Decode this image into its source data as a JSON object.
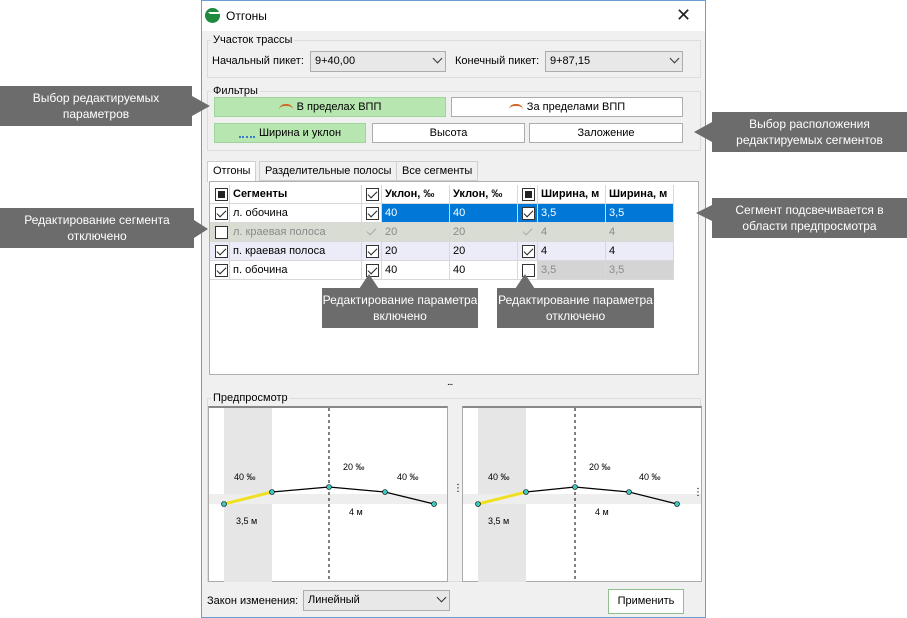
{
  "window": {
    "title": "Отгоны",
    "close_icon": "close-icon"
  },
  "section": {
    "label": "Участок трассы",
    "start_label": "Начальный пикет:",
    "start_value": "9+40,00",
    "end_label": "Конечный пикет:",
    "end_value": "9+87,15"
  },
  "filters": {
    "label": "Фильтры",
    "inside": "В пределах ВПП",
    "outside": "За  пределами ВПП",
    "width_slope": "Ширина и уклон",
    "height": "Высота",
    "layout": "Заложение"
  },
  "tabs": [
    "Отгоны",
    "Разделительные полосы",
    "Все сегменты"
  ],
  "table": {
    "headers": [
      "Сегменты",
      "Уклон, ‰",
      "Уклон, ‰",
      "Ширина, м",
      "Ширина, м"
    ],
    "rows": [
      {
        "name": "л. обочина",
        "s1": "40",
        "s2": "40",
        "w1": "3,5",
        "w2": "3,5"
      },
      {
        "name": "л. краевая полоса",
        "s1": "20",
        "s2": "20",
        "w1": "4",
        "w2": "4"
      },
      {
        "name": "п. краевая полоса",
        "s1": "20",
        "s2": "20",
        "w1": "4",
        "w2": "4"
      },
      {
        "name": "п. обочина",
        "s1": "40",
        "s2": "40",
        "w1": "3,5",
        "w2": "3,5"
      }
    ]
  },
  "splitter": "...",
  "preview": {
    "label": "Предпросмотр",
    "left_slope": "40 ‰",
    "mid_slope": "20 ‰",
    "right_slope": "40 ‰",
    "width_left": "3,5 м",
    "width_mid": "4 м"
  },
  "bottom": {
    "law_label": "Закон изменения:",
    "law_value": "Линейный",
    "apply": "Применить"
  },
  "callouts": {
    "params": "Выбор редактируемых параметров",
    "location": "Выбор расположения редактируемых сегментов",
    "seg_disabled": "Редактирование сегмента отключено",
    "highlight": "Сегмент подсвечивается в области предпросмотра",
    "param_on": "Редактирование параметра включено",
    "param_off": "Редактирование параметра отключено"
  },
  "colors": {
    "selection": "#0078d7",
    "filter_active": "#b8e6b0",
    "callout": "#6c6c6c",
    "highlight_line": "#f0e020"
  }
}
